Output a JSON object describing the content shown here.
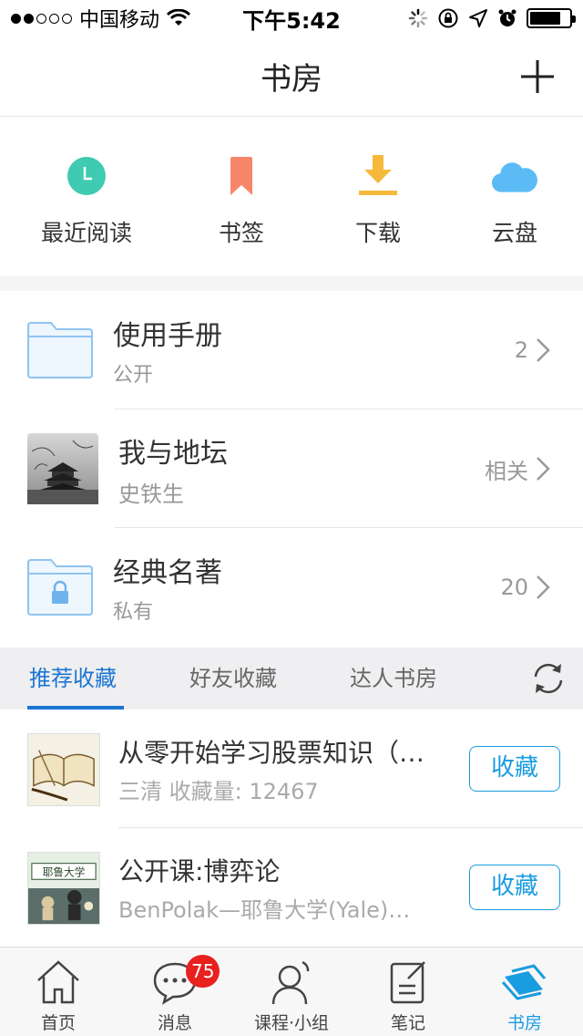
{
  "status_bar": {
    "carrier": "中国移动",
    "time": "下午5:42"
  },
  "header": {
    "title": "书房"
  },
  "quick_actions": [
    {
      "label": "最近阅读",
      "icon": "clock-icon",
      "color": "#3fcbb1"
    },
    {
      "label": "书签",
      "icon": "bookmark-icon",
      "color": "#f6866a"
    },
    {
      "label": "下载",
      "icon": "download-icon",
      "color": "#f6b93b"
    },
    {
      "label": "云盘",
      "icon": "cloud-icon",
      "color": "#5bbcf5"
    }
  ],
  "shelf": [
    {
      "name": "使用手册",
      "sub": "公开",
      "meta": "2",
      "icon": "folder-icon"
    },
    {
      "name": "我与地坛",
      "sub": "史铁生",
      "meta": "相关",
      "icon": "book-cover-temple"
    },
    {
      "name": "经典名著",
      "sub": "私有",
      "meta": "20",
      "icon": "locked-folder-icon"
    }
  ],
  "tabs": [
    {
      "label": "推荐收藏"
    },
    {
      "label": "好友收藏"
    },
    {
      "label": "达人书房"
    }
  ],
  "recommend": [
    {
      "title": "从零开始学习股票知识（…",
      "desc": "三清  收藏量: 12467",
      "button": "收藏"
    },
    {
      "title": "公开课:博弈论",
      "desc": "BenPolak—耶鲁大学(Yale)…",
      "button": "收藏",
      "cover_text": "耶鲁大学"
    }
  ],
  "tabbar": [
    {
      "label": "首页",
      "icon": "home-icon"
    },
    {
      "label": "消息",
      "icon": "message-icon",
      "badge": "75"
    },
    {
      "label": "课程·小组",
      "icon": "person-icon"
    },
    {
      "label": "笔记",
      "icon": "note-icon"
    },
    {
      "label": "书房",
      "icon": "bookshelf-icon"
    }
  ],
  "colors": {
    "accent": "#1a76d2",
    "button_border": "#1a9ce0",
    "badge": "#e8201e"
  }
}
